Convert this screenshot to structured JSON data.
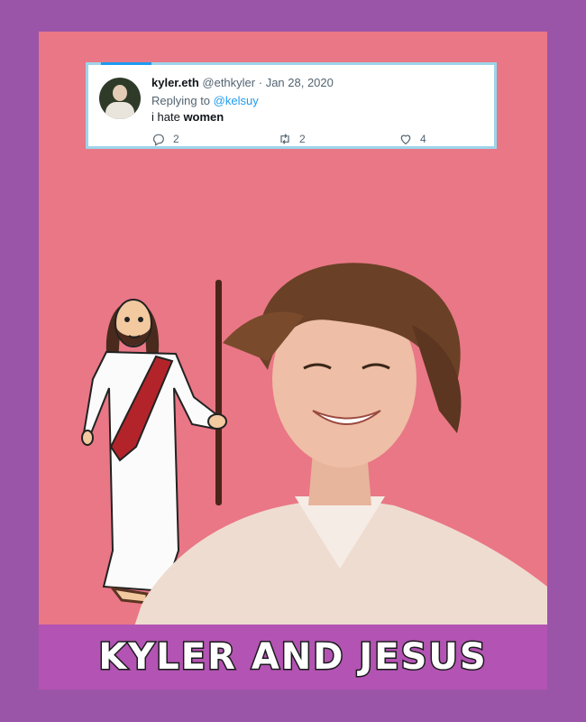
{
  "tweet": {
    "display_name": "kyler.eth",
    "handle": "@ethkyler",
    "date": "Jan 28, 2020",
    "replying_prefix": "Replying to",
    "replying_to": "@kelsuy",
    "text_prefix": "i hate",
    "text_bold": "women",
    "reply_count": "2",
    "retweet_count": "2",
    "like_count": "4",
    "icons": [
      "reply-icon",
      "retweet-icon",
      "like-icon"
    ]
  },
  "banner": {
    "title": "KYLER AND JESUS"
  },
  "colors": {
    "outer": "#9b55a8",
    "inner": "#e97786",
    "banner": "#b353b3",
    "twitter_blue": "#1d9bf0"
  }
}
